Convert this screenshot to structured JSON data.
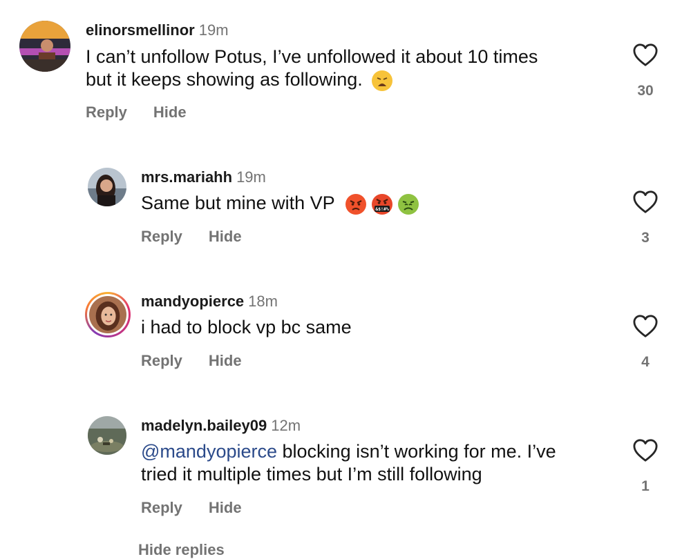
{
  "comments": [
    {
      "username": "elinorsmellinor",
      "time": "19m",
      "line1": "I can’t unfollow Potus, I’ve unfollowed it about 10 times",
      "line2": "but it keeps showing as following.",
      "likes": "30",
      "reply_label": "Reply",
      "hide_label": "Hide",
      "emojis": [
        "weary-face"
      ]
    },
    {
      "username": "mrs.mariahh",
      "time": "19m",
      "line1": "Same but mine with VP",
      "likes": "3",
      "reply_label": "Reply",
      "hide_label": "Hide",
      "emojis": [
        "angry-face",
        "face-with-symbols-on-mouth",
        "nauseated-face"
      ],
      "symbols_text": "&$!#%"
    },
    {
      "username": "mandyopierce",
      "time": "18m",
      "line1": "i had to block vp bc same",
      "likes": "4",
      "reply_label": "Reply",
      "hide_label": "Hide"
    },
    {
      "username": "madelyn.bailey09",
      "time": "12m",
      "mention": "@mandyopierce",
      "line1": " blocking isn’t working for me. I’ve",
      "line2": "tried it multiple times but I’m still following",
      "likes": "1",
      "reply_label": "Reply",
      "hide_label": "Hide"
    }
  ],
  "footer": {
    "hide_replies_label": "Hide replies"
  },
  "colors": {
    "mention": "#2b4a8a",
    "secondary_text": "#737373"
  }
}
